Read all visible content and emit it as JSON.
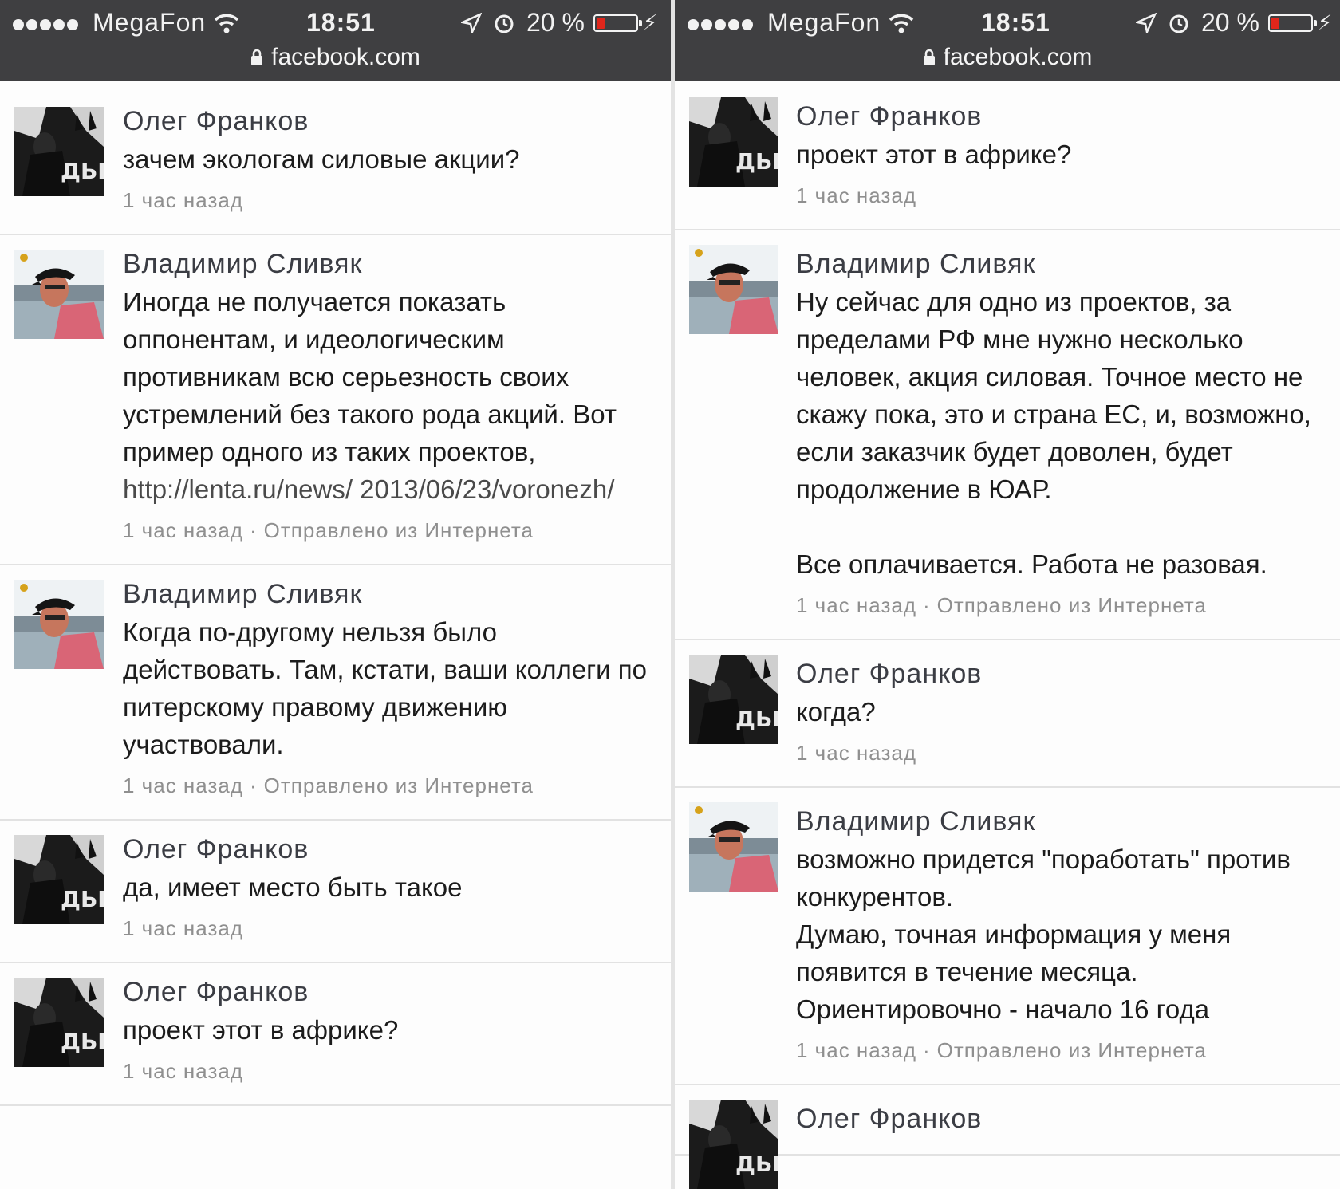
{
  "status_bar": {
    "carrier": "MegaFon",
    "time": "18:51",
    "battery": "20 %",
    "battery_level": 0.2,
    "url": "facebook.com"
  },
  "left_panel": {
    "comments": [
      {
        "author": "Олег Франков",
        "text": "зачем экологам силовые акции?",
        "time": "1 час назад",
        "source": ""
      },
      {
        "author": "Владимир Сливяк",
        "text": "Иногда не получается показать оппонентам, и идеологическим противникам всю серьезность своих устремлений без такого рода акций. Вот пример одного из таких проектов,",
        "link": "http://lenta.ru/news/ 2013/06/23/voronezh/",
        "time": "1 час назад",
        "source": "Отправлено из Интернета"
      },
      {
        "author": "Владимир Сливяк",
        "text": "Когда по-другому нельзя было действовать. Там, кстати, ваши коллеги по питерскому правому движению участвовали.",
        "time": "1 час назад",
        "source": "Отправлено из Интернета"
      },
      {
        "author": "Олег Франков",
        "text": "да, имеет место быть такое",
        "time": "1 час назад",
        "source": ""
      },
      {
        "author": "Олег Франков",
        "text": "проект этот в африке?",
        "time": "1 час назад",
        "source": ""
      }
    ]
  },
  "right_panel": {
    "comments": [
      {
        "author": "Олег Франков",
        "text": "проект этот в африке?",
        "time": "1 час назад",
        "source": ""
      },
      {
        "author": "Владимир Сливяк",
        "text": "Ну сейчас для одно из проектов, за пределами РФ мне нужно несколько человек, акция силовая. Точное место не скажу пока, это и страна ЕС, и, возможно, если заказчик будет доволен, будет продолжение в ЮАР.\n\nВсе оплачивается. Работа не разовая.",
        "time": "1 час назад",
        "source": "Отправлено из Интернета"
      },
      {
        "author": "Олег Франков",
        "text": "когда?",
        "time": "1 час назад",
        "source": ""
      },
      {
        "author": "Владимир Сливяк",
        "text": "возможно придется \"поработать\" против конкурентов.\nДумаю, точная информация у меня появится в течение месяца.\nОриентировочно - начало 16 года",
        "time": "1 час назад",
        "source": "Отправлено из Интернета"
      },
      {
        "author": "Олег Франков",
        "text": "",
        "time": "",
        "source": ""
      }
    ]
  },
  "meta_separator": "·"
}
